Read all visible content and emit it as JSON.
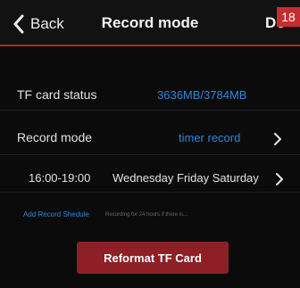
{
  "header": {
    "back_label": "Back",
    "title": "Record mode",
    "done_label": "Do",
    "badge": "18"
  },
  "tf_card": {
    "label": "TF card status",
    "value": "3636MB/3784MB"
  },
  "record_mode": {
    "label": "Record mode",
    "value": "timer record"
  },
  "schedule": {
    "time": "16:00-19:00",
    "days": "Wednesday Friday Saturday"
  },
  "add_schedule": {
    "link": "Add Record Shedule",
    "hint": "Recording for 24 hours if there is..."
  },
  "actions": {
    "reformat_label": "Reformat TF Card"
  },
  "colors": {
    "accent_red": "#b3272c",
    "button_red": "#8e1f26",
    "link_blue": "#2f86d6",
    "background": "#0b0b0b"
  },
  "icons": {
    "back": "chevron-left-icon",
    "row_arrow": "chevron-right-icon"
  }
}
